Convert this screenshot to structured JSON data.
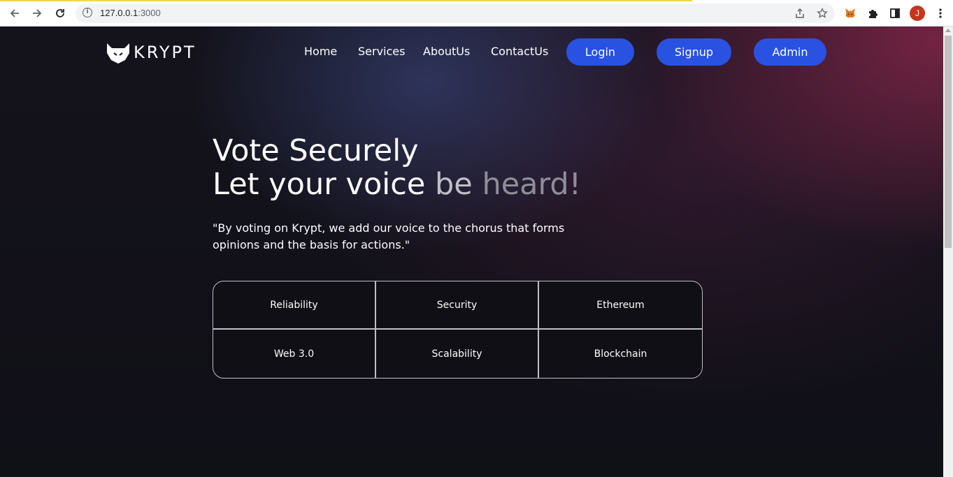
{
  "browser": {
    "url_host": "127.0.0.1",
    "url_port": ":3000",
    "profile_initial": "J",
    "icons": [
      "back-icon",
      "forward-icon",
      "reload-icon",
      "site-info-icon",
      "share-icon",
      "bookmark-star-icon",
      "metamask-fox-icon",
      "extensions-puzzle-icon",
      "side-panel-icon",
      "avatar",
      "menu-dots-icon"
    ]
  },
  "brand": {
    "name": "KRYPT",
    "logo_icon": "fox-logo-icon"
  },
  "nav": {
    "links": [
      "Home",
      "Services",
      "AboutUs",
      "ContactUs"
    ],
    "buttons": [
      "Login",
      "Signup",
      "Admin"
    ]
  },
  "hero": {
    "line1": "Vote Securely",
    "line2_a": "Let your voice ",
    "line2_b": "be ",
    "line2_c": "heard!",
    "quote": "\"By voting on Krypt, we add our voice to the chorus that forms opinions and the basis for actions.\""
  },
  "features": [
    "Reliability",
    "Security",
    "Ethereum",
    "Web 3.0",
    "Scalability",
    "Blockchain"
  ],
  "colors": {
    "accent": "#2952e3",
    "background": "#111018",
    "glow_blue": "#343e6e",
    "glow_red": "#78244a"
  }
}
